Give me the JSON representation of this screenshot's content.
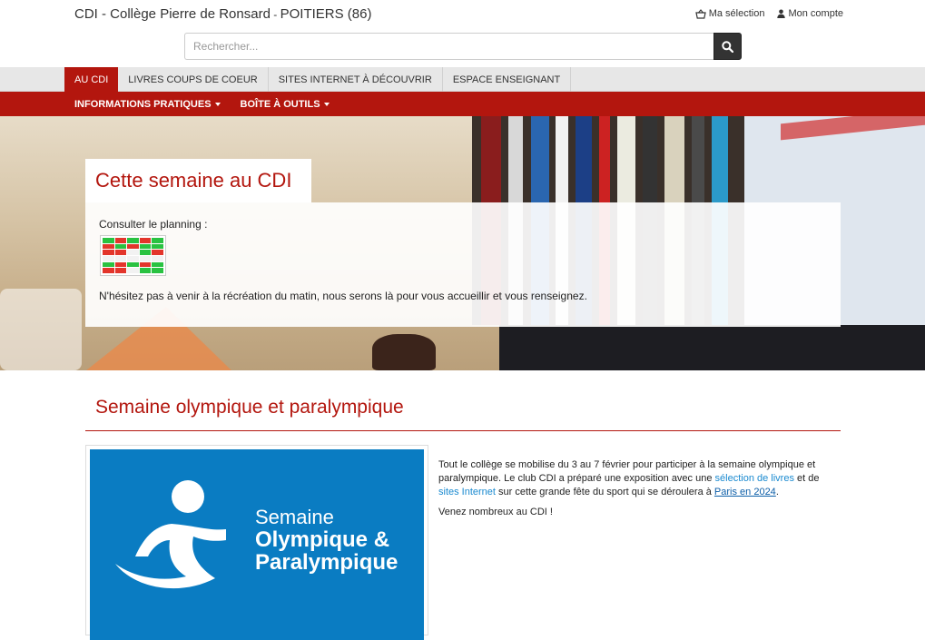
{
  "header": {
    "site_title_main": "CDI - Collège Pierre de Ronsard",
    "site_title_sep": " - ",
    "site_title_city": "POITIERS (86)",
    "my_selection": "Ma sélection",
    "my_account": "Mon compte"
  },
  "search": {
    "placeholder": "Rechercher...",
    "button_icon": "search-icon"
  },
  "nav_primary": {
    "items": [
      {
        "label": "AU CDI",
        "active": true
      },
      {
        "label": "LIVRES COUPS DE COEUR",
        "active": false
      },
      {
        "label": "SITES INTERNET À DÉCOUVRIR",
        "active": false
      },
      {
        "label": "ESPACE ENSEIGNANT",
        "active": false
      }
    ]
  },
  "nav_secondary": {
    "items": [
      {
        "label": "INFORMATIONS PRATIQUES"
      },
      {
        "label": "BOÎTE À OUTILS"
      }
    ]
  },
  "hero_card": {
    "title": "Cette semaine au CDI",
    "line1": "Consulter le planning :",
    "line2": "N'hésitez pas à venir à la récréation du matin, nous serons là pour vous accueillir et vous renseignez."
  },
  "article": {
    "title": "Semaine olympique et paralympique",
    "image_text_line1": "Semaine",
    "image_text_line2": "Olympique &",
    "image_text_line3": "Paralympique",
    "p1_a": "Tout le collège se mobilise du 3 au 7 février pour participer à la semaine olympique et paralympique. Le club CDI a préparé une exposition avec une ",
    "p1_link1": "sélection de livres",
    "p1_b": " et de ",
    "p1_link2": "sites Internet",
    "p1_c": " sur cette grande fête du sport qui se déroulera à ",
    "p1_link3": "Paris en 2024",
    "p1_d": ".",
    "p2": "Venez nombreux au CDI !"
  },
  "colors": {
    "brand_red": "#b3160e",
    "link_blue": "#1a8ad0",
    "image_blue": "#0a7cc2"
  }
}
